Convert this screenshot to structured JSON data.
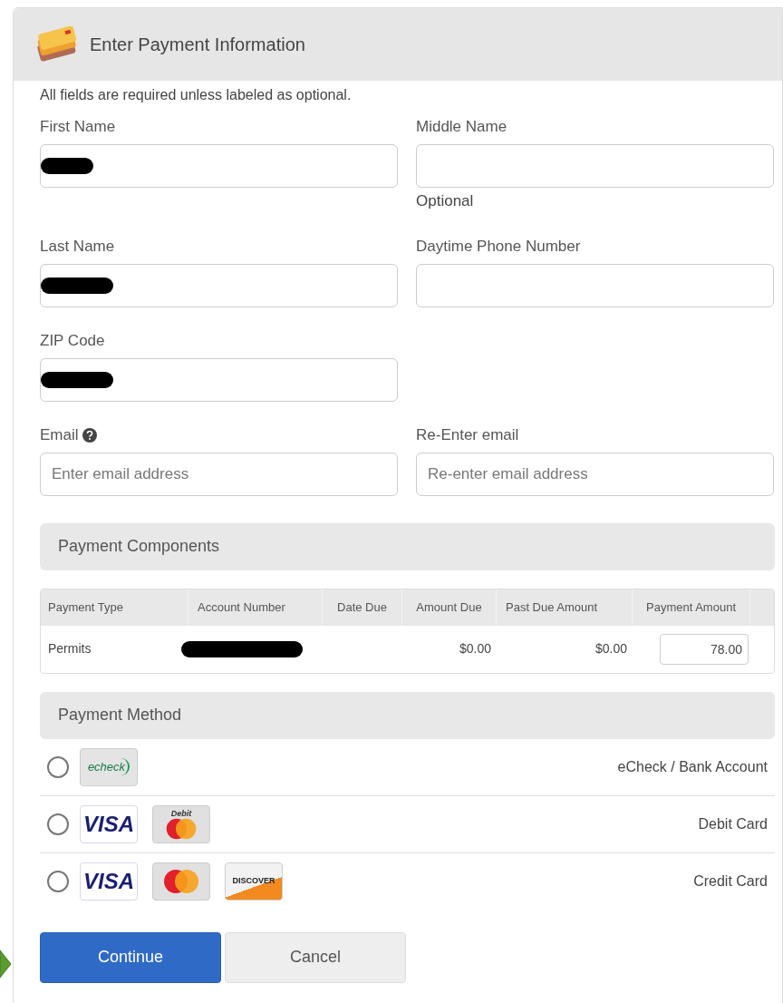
{
  "header": {
    "title": "Enter Payment Information"
  },
  "note": "All fields are required unless labeled as optional.",
  "field_rows": [
    [
      {
        "label": "First Name",
        "redacted": true
      },
      {
        "label": "Middle Name",
        "hint": "Optional"
      }
    ],
    [
      {
        "label": "Last Name",
        "redacted": true
      },
      {
        "label": "Daytime Phone Number"
      }
    ],
    [
      {
        "label": "ZIP Code",
        "redacted": true
      }
    ],
    [
      {
        "label": "Email",
        "help": true,
        "placeholder": "Enter email address"
      },
      {
        "label": "Re-Enter email",
        "placeholder": "Re-enter email address"
      }
    ]
  ],
  "payment_components": {
    "title": "Payment Components",
    "table": {
      "columns": [
        "Payment Type",
        "Account Number",
        "Date Due",
        "Amount Due",
        "Past Due Amount",
        "Payment Amount"
      ],
      "rows": [
        {
          "payment_type": "Permits",
          "account_redacted": true,
          "amount_due": "$0.00",
          "past_due_amount": "$0.00",
          "payment_amount": "78.00"
        }
      ]
    }
  },
  "payment_method": {
    "title": "Payment Method",
    "options": [
      {
        "selected": false,
        "label": "eCheck / Bank Account",
        "logos": [
          {
            "kind": "echeck",
            "text": "echeck"
          }
        ]
      },
      {
        "selected": false,
        "label": "Debit Card",
        "logos": [
          {
            "kind": "visa",
            "text": "VISA"
          },
          {
            "kind": "mastercard",
            "text": "Debit"
          }
        ]
      },
      {
        "selected": false,
        "label": "Credit Card",
        "logos": [
          {
            "kind": "visa",
            "text": "VISA"
          },
          {
            "kind": "mastercard"
          },
          {
            "kind": "discover",
            "text": "DISCOVER"
          }
        ]
      }
    ]
  },
  "buttons": [
    {
      "kind": "primary",
      "label": "Continue"
    },
    {
      "kind": "secondary",
      "label": "Cancel"
    }
  ]
}
